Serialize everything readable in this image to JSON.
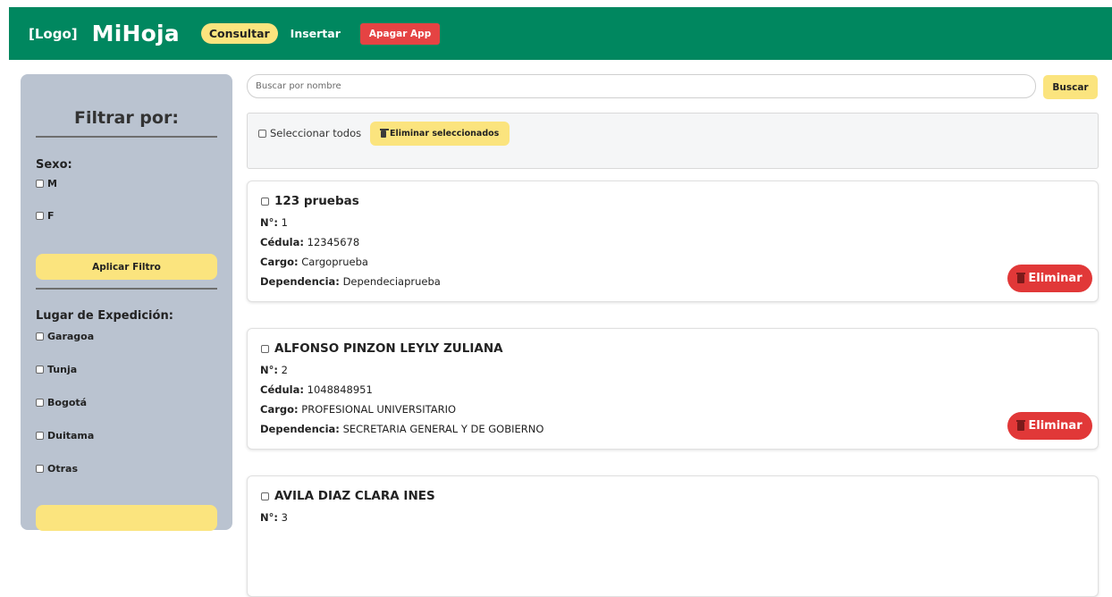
{
  "header": {
    "logo": "[Logo]",
    "brand": "MiHoja",
    "nav": {
      "consultar": "Consultar",
      "insertar": "Insertar",
      "apagar": "Apagar App"
    }
  },
  "sidebar": {
    "title": "Filtrar por:",
    "sexo": {
      "label": "Sexo:",
      "options": [
        "M",
        "F"
      ]
    },
    "apply_label": "Aplicar Filtro",
    "lugar": {
      "label": "Lugar de Expedición:",
      "options": [
        "Garagoa",
        "Tunja",
        "Bogotá",
        "Duitama",
        "Otras"
      ]
    }
  },
  "search": {
    "placeholder": "Buscar por nombre",
    "button_label": "Buscar"
  },
  "bulk": {
    "select_all_label": "Seleccionar todos",
    "delete_selected_label": "Eliminar seleccionados"
  },
  "field_labels": {
    "num": "N°:",
    "cedula": "Cédula:",
    "cargo": "Cargo:",
    "dependencia": "Dependencia:"
  },
  "delete_label": "Eliminar",
  "records": [
    {
      "name": "123 pruebas",
      "num": "1",
      "cedula": "12345678",
      "cargo": "Cargoprueba",
      "dependencia": "Dependeciaprueba"
    },
    {
      "name": "ALFONSO PINZON LEYLY ZULIANA",
      "num": "2",
      "cedula": "1048848951",
      "cargo": "PROFESIONAL UNIVERSITARIO",
      "dependencia": "SECRETARIA GENERAL Y DE GOBIERNO"
    },
    {
      "name": "AVILA DIAZ CLARA INES",
      "num": "3"
    }
  ],
  "colors": {
    "header_green": "#00875f",
    "accent_yellow": "#fbe47e",
    "danger_red": "#e13838",
    "sidebar_bg": "#bac3d0"
  }
}
